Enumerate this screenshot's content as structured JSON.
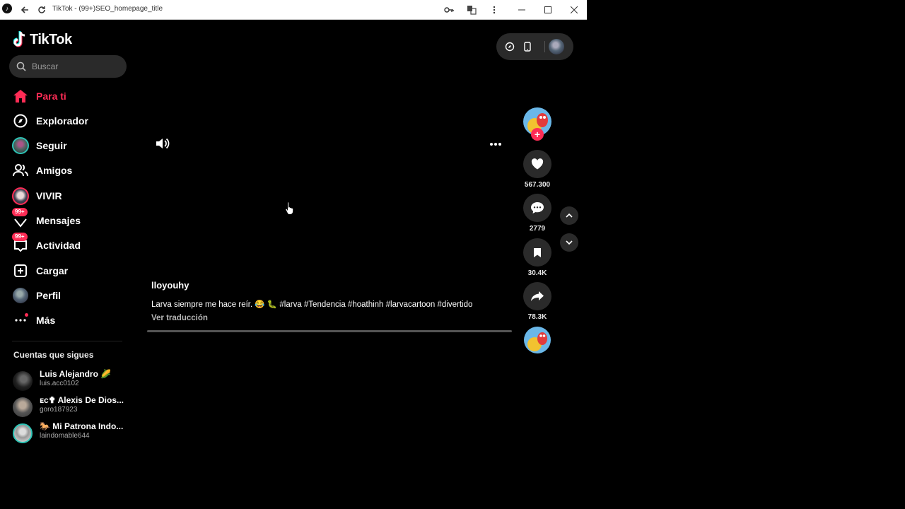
{
  "window": {
    "title": "TikTok - (99+)SEO_homepage_title"
  },
  "sidebar": {
    "logo_text": "TikTok",
    "search_placeholder": "Buscar",
    "nav": [
      {
        "label": "Para ti",
        "icon": "home-icon",
        "active": true
      },
      {
        "label": "Explorador",
        "icon": "compass-icon"
      },
      {
        "label": "Seguir",
        "icon": "following-avatar-icon"
      },
      {
        "label": "Amigos",
        "icon": "friends-icon"
      },
      {
        "label": "VIVIR",
        "icon": "live-avatar-icon"
      },
      {
        "label": "Mensajes",
        "icon": "messages-icon",
        "badge": "99+"
      },
      {
        "label": "Actividad",
        "icon": "activity-icon",
        "badge": "99+"
      },
      {
        "label": "Cargar",
        "icon": "upload-icon"
      },
      {
        "label": "Perfil",
        "icon": "profile-avatar-icon"
      },
      {
        "label": "Más",
        "icon": "more-icon"
      }
    ],
    "following_title": "Cuentas que sigues",
    "following": [
      {
        "name": "Luis Alejandro 🌽",
        "handle": "luis.acc0102"
      },
      {
        "name": "ᴇᴄ✟ Alexis De Dios...",
        "handle": "goro187923"
      },
      {
        "name": "🐎 Mi Patrona Indo...",
        "handle": "laindomable644"
      }
    ]
  },
  "video": {
    "author": "lloyouhy",
    "caption": "Larva siempre me hace reír. 😂 🐛 #larva #Tendencia #hoathinh #larvacartoon #divertido",
    "translate_label": "Ver traducción"
  },
  "actions": {
    "likes": "567.300",
    "comments": "2779",
    "saves": "30.4K",
    "shares": "78.3K",
    "follow_plus": "+"
  },
  "colors": {
    "accent": "#fe2c55",
    "background": "#000000",
    "button_bg": "#2a2a2a"
  }
}
